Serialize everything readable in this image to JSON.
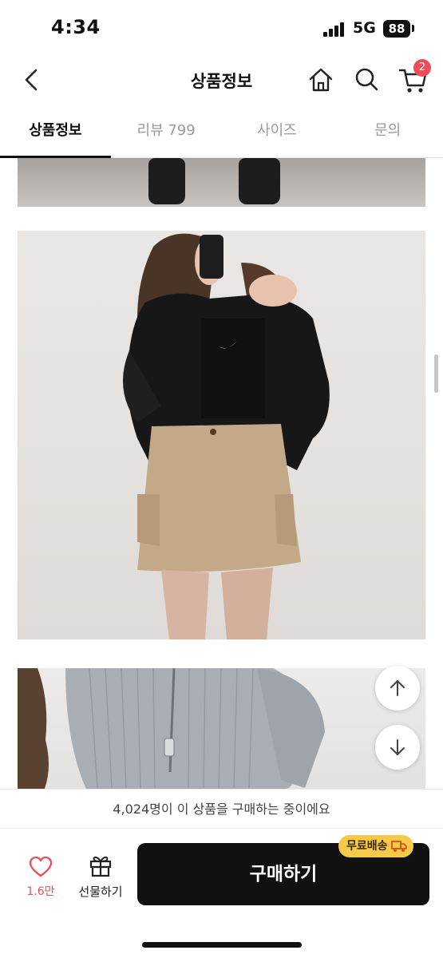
{
  "status_bar": {
    "time": "4:34",
    "network": "5G",
    "battery": "88"
  },
  "header": {
    "title": "상품정보",
    "cart_count": "2"
  },
  "tabs": [
    {
      "label": "상품정보",
      "active": true
    },
    {
      "label": "리뷰 799",
      "active": false
    },
    {
      "label": "사이즈",
      "active": false
    },
    {
      "label": "문의",
      "active": false
    }
  ],
  "icons": {
    "back": "chevron-left-icon",
    "home": "home-icon",
    "search": "search-icon",
    "cart": "cart-icon",
    "scroll_up": "arrow-up-icon",
    "scroll_down": "arrow-down-icon",
    "like": "heart-icon",
    "gift": "gift-icon",
    "shipping": "truck-icon"
  },
  "buyers_text": "4,024명이 이 상품을 구매하는 중이에요",
  "bottom": {
    "like_count": "1.6만",
    "gift_label": "선물하기",
    "buy_label": "구매하기",
    "shipping_badge": "무료배송"
  },
  "colors": {
    "accent": "#ef4b5b",
    "badge": "#f7c948",
    "primary_button": "#111111"
  }
}
